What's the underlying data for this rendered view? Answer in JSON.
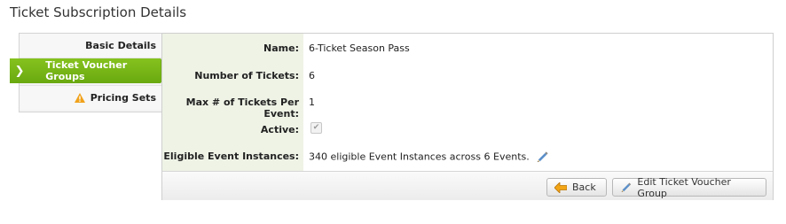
{
  "page": {
    "title": "Ticket Subscription Details"
  },
  "nav": {
    "items": [
      {
        "label": "Basic Details"
      },
      {
        "label": "Ticket Voucher Groups",
        "active": true,
        "icon": "chevron-right-icon"
      },
      {
        "label": "Pricing Sets",
        "icon": "warning-icon"
      }
    ]
  },
  "details": {
    "rows": [
      {
        "label": "Name:",
        "value": "6-Ticket Season Pass"
      },
      {
        "label": "Number of Tickets:",
        "value": "6"
      },
      {
        "label": "Max # of Tickets Per Event:",
        "value": "1"
      },
      {
        "label": "Active:",
        "checked": true
      },
      {
        "label": "Eligible Event Instances:",
        "value": "340 eligible Event Instances across 6 Events.",
        "icon": "pencil-icon"
      }
    ]
  },
  "footer": {
    "back_label": "Back",
    "edit_label": "Edit Ticket Voucher Group"
  },
  "colors": {
    "accent": "#7ab51a",
    "label_bg": "#eef3e6"
  }
}
